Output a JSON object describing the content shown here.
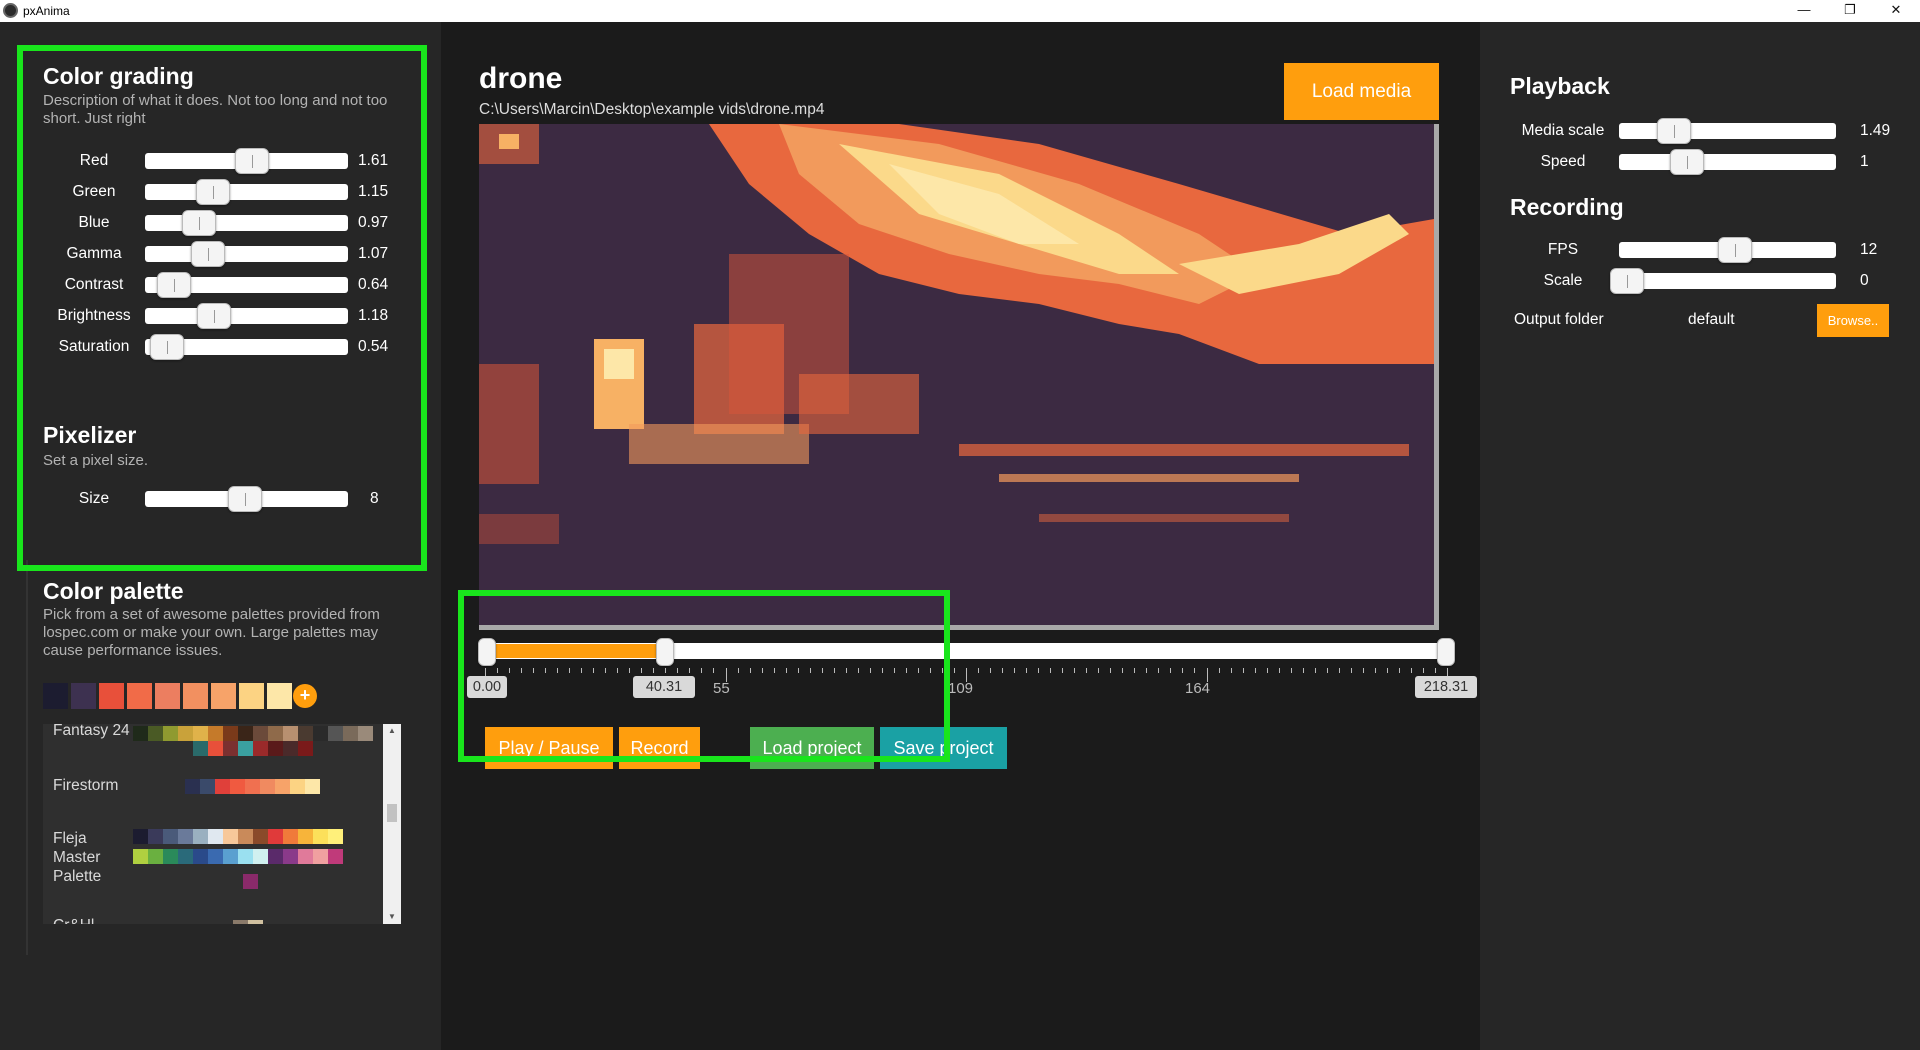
{
  "window": {
    "title": "pxAnima",
    "minimize": "—",
    "maximize": "❐",
    "close": "✕"
  },
  "color_grading": {
    "title": "Color grading",
    "description": "Description of what it does. Not too long and not too short. Just right",
    "sliders": [
      {
        "label": "Red",
        "value": "1.61",
        "level": 0.53
      },
      {
        "label": "Green",
        "value": "1.15",
        "level": 0.3
      },
      {
        "label": "Blue",
        "value": "0.97",
        "level": 0.22
      },
      {
        "label": "Gamma",
        "value": "1.07",
        "level": 0.27
      },
      {
        "label": "Contrast",
        "value": "0.64",
        "level": 0.07
      },
      {
        "label": "Brightness",
        "value": "1.18",
        "level": 0.31
      },
      {
        "label": "Saturation",
        "value": "0.54",
        "level": 0.03
      }
    ]
  },
  "pixelizer": {
    "title": "Pixelizer",
    "description": "Set a pixel size.",
    "size_label": "Size",
    "size_value": "8",
    "size_level": 0.49
  },
  "color_palette": {
    "title": "Color palette",
    "description": "Pick from a set of awesome palettes provided from lospec.com or make your own. Large palettes may cause performance issues.",
    "current": [
      "#1c1c30",
      "#3d3150",
      "#e8503a",
      "#f16b48",
      "#ec7e60",
      "#f29060",
      "#f7a369",
      "#fcd383",
      "#fde7a8"
    ],
    "add_label": "+",
    "list": [
      {
        "name": "Fantasy 24"
      },
      {
        "name": "Firestorm"
      },
      {
        "name": "Fleja Master Palette"
      },
      {
        "name": "Cr&Hl"
      }
    ]
  },
  "media": {
    "title": "drone",
    "path": "C:\\Users\\Marcin\\Desktop\\example vids\\drone.mp4",
    "load_label": "Load media"
  },
  "timeline": {
    "start": "0.00",
    "current": "40.31",
    "end": "218.31",
    "tick_labels": [
      "55",
      "109",
      "164"
    ],
    "progress": 0.185
  },
  "buttons": {
    "play_pause": "Play / Pause",
    "record": "Record",
    "load_project": "Load project",
    "save_project": "Save project"
  },
  "playback": {
    "title": "Playback",
    "media_scale_label": "Media scale",
    "media_scale_value": "1.49",
    "media_scale_level": 0.21,
    "speed_label": "Speed",
    "speed_value": "1",
    "speed_level": 0.28
  },
  "recording": {
    "title": "Recording",
    "fps_label": "FPS",
    "fps_value": "12",
    "fps_level": 0.54,
    "scale_label": "Scale",
    "scale_value": "0",
    "scale_level": 0.0,
    "output_label": "Output folder",
    "output_value": "default",
    "browse_label": "Browse.."
  },
  "colors": {
    "accent_orange": "#ff9e0d",
    "green_button": "#4caf50",
    "teal_button": "#1aa1a4",
    "highlight": "#19e51c"
  }
}
